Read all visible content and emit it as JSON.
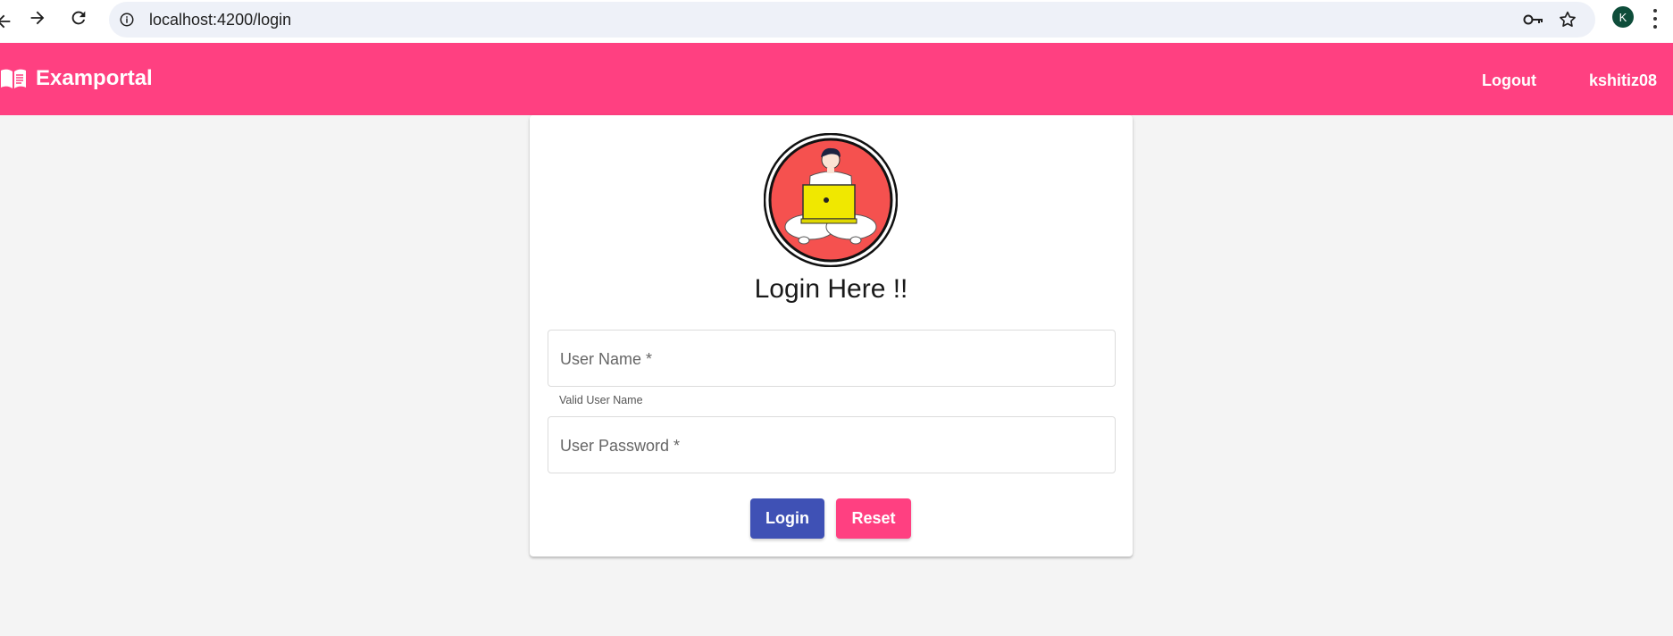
{
  "browser": {
    "url": "localhost:4200/login",
    "profile_initial": "K",
    "icons": [
      "back-arrow-icon",
      "forward-arrow-icon",
      "reload-icon",
      "info-icon",
      "key-icon",
      "star-icon",
      "more-vert-icon"
    ]
  },
  "toolbar": {
    "brand_title": "Examportal",
    "brand_icon": "menu-book-icon",
    "logout_label": "Logout",
    "username": "kshitiz08",
    "color": "#ff4081"
  },
  "card": {
    "title": "Login Here !!",
    "avatar_icon": "user-laptop-avatar",
    "username_label": "User Name *",
    "username_hint": "Valid User Name",
    "password_label": "User Password *",
    "login_label": "Login",
    "reset_label": "Reset",
    "login_color": "#3f51b5",
    "reset_color": "#ff4081"
  }
}
